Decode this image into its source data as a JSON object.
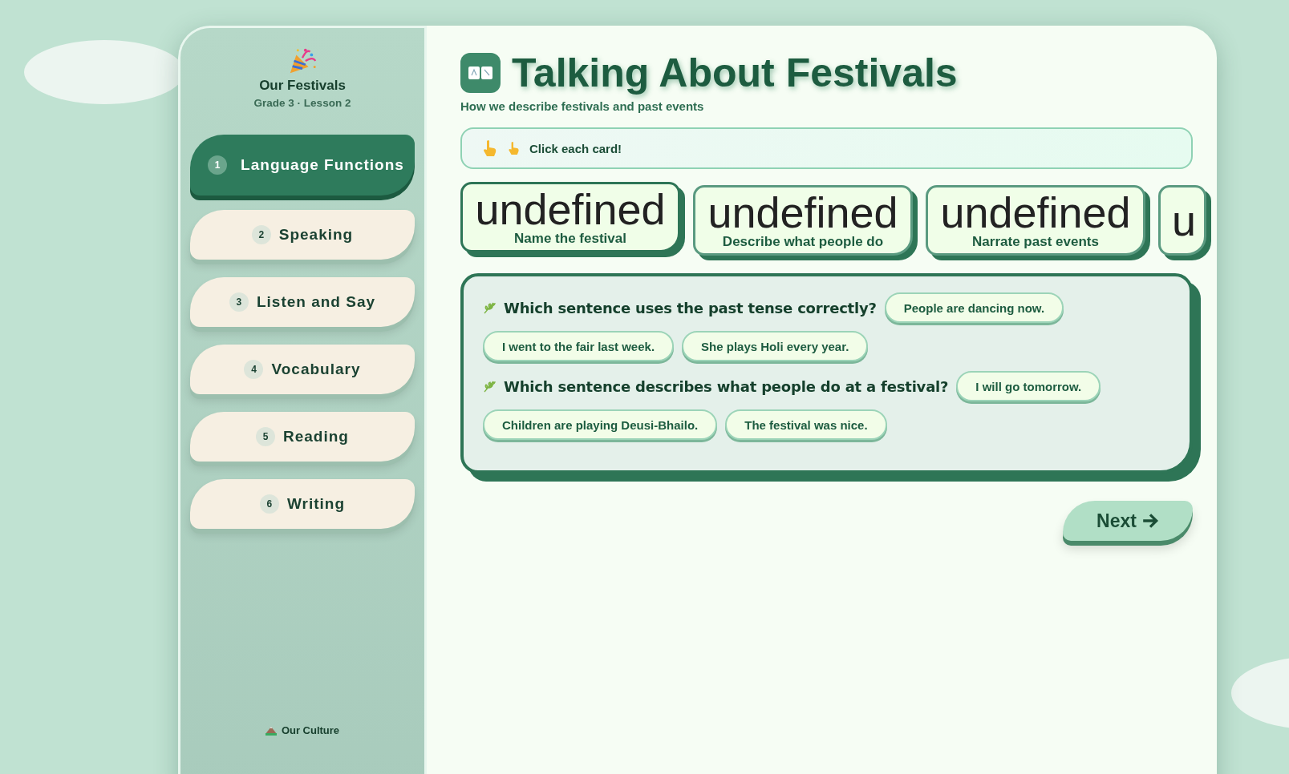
{
  "sidebar": {
    "title": "Our Festivals",
    "subtitle": "Grade 3 · Lesson 2",
    "items": [
      {
        "number": "1",
        "label": "Language Functions",
        "selected": true
      },
      {
        "number": "2",
        "label": "Speaking",
        "selected": false
      },
      {
        "number": "3",
        "label": "Listen and Say",
        "selected": false
      },
      {
        "number": "4",
        "label": "Vocabulary",
        "selected": false
      },
      {
        "number": "5",
        "label": "Reading",
        "selected": false
      },
      {
        "number": "6",
        "label": "Writing",
        "selected": false
      }
    ],
    "footer": "Our Culture"
  },
  "header": {
    "title": "Talking About Festivals",
    "subtitle": "How we describe festivals and past events"
  },
  "hint": "Click each card!",
  "cards": [
    {
      "title": "undefined",
      "caption": "Name the festival",
      "selected": true
    },
    {
      "title": "undefined",
      "caption": "Describe what people do",
      "selected": false
    },
    {
      "title": "undefined",
      "caption": "Narrate past events",
      "selected": false
    },
    {
      "title": "u",
      "selected": false
    }
  ],
  "questions": [
    {
      "text": "Which sentence uses the past tense correctly?",
      "options": [
        "People are dancing now.",
        "I went to the fair last week.",
        "She plays Holi every year."
      ]
    },
    {
      "text": "Which sentence describes what people do at a festival?",
      "options": [
        "I will go tomorrow.",
        "Children are playing Deusi-Bhailo.",
        "The festival was nice."
      ]
    }
  ],
  "next_button": "Next"
}
